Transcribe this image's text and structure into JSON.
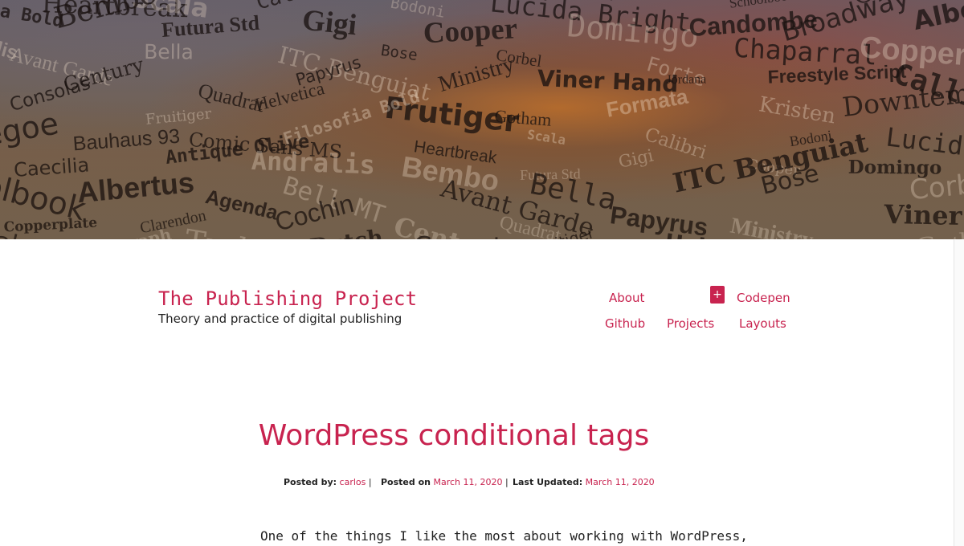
{
  "banner": {
    "words": [
      "Helvetica",
      "Frutiger",
      "Gotham",
      "Formata",
      "Kristen",
      "Downtempo",
      "Snap",
      "Segoe",
      "Bauhaus 93",
      "Comic Sans MS",
      "Filosofia Bold",
      "Heartbreak",
      "Scala",
      "Calibri",
      "Bodoni",
      "Lucida Bright",
      "Eras Bold",
      "Schoolbook",
      "Caecilia",
      "Antique Olive",
      "Andralis",
      "Bembo",
      "Futura Std",
      "Gigi",
      "Cooper",
      "Domingo",
      "Candombe",
      "Broadway",
      "Albertus",
      "Agenda",
      "Bell MT",
      "Avant Garde",
      "Bella",
      "ITC Benguiat",
      "Bose",
      "Corbel",
      "Forte",
      "Chaparral",
      "Copperplate",
      "Clarendon",
      "Cochin",
      "Century",
      "Quadrat",
      "Papyrus",
      "Ministry",
      "Viner Hand",
      "Jordana",
      "Freestyle Script",
      "Calligraph",
      "Trebuchet",
      "Dutch",
      "Consolas",
      "Fruitiger"
    ]
  },
  "site": {
    "title": "The Publishing Project",
    "tagline": "Theory and practice of digital publishing"
  },
  "nav": {
    "about": "About",
    "plus": "+",
    "codepen": "Codepen",
    "github": "Github",
    "projects": "Projects",
    "layouts": "Layouts"
  },
  "post": {
    "title": "WordPress conditional tags",
    "posted_by_label": "Posted by:",
    "author": "carlos",
    "posted_on_label": "Posted on",
    "posted_on": "March 11, 2020",
    "updated_label": "Last Updated:",
    "updated": "March 11, 2020",
    "separator": "|",
    "first_line": "One of the things I like the most about working with WordPress,"
  },
  "colors": {
    "accent": "#c8234f",
    "text": "#222222",
    "background": "#ffffff"
  }
}
